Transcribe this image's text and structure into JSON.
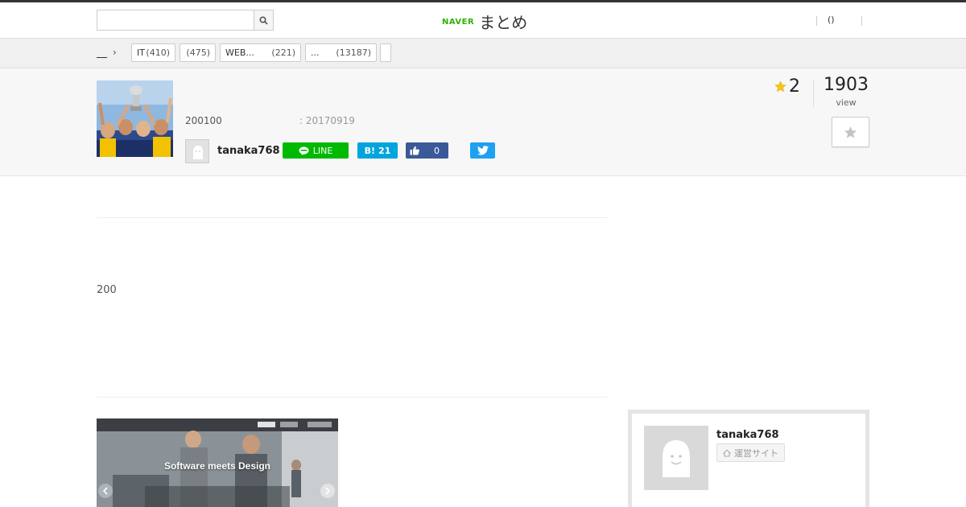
{
  "header": {
    "search": {
      "value": "",
      "placeholder": ""
    },
    "logo_brand": "NAVER",
    "logo_text": "まとめ",
    "user_link": "()"
  },
  "category_bar": {
    "chips": [
      {
        "label": "IT",
        "count": "(410)"
      },
      {
        "label": "",
        "count": "(475)"
      },
      {
        "label": "WEB...",
        "count": "(221)"
      },
      {
        "label": "...",
        "count": "(13187)"
      },
      {
        "label": "",
        "count": ""
      }
    ]
  },
  "summary": {
    "description": "200100",
    "updated": ": 20170919",
    "author": "tanaka768",
    "share": {
      "line_label": "LINE",
      "hatena_icon_text": "B!",
      "hatena_count": "21",
      "facebook_count": "0"
    },
    "favorites": "2",
    "views": "1903",
    "views_label": "view"
  },
  "main": {
    "body_number": "200",
    "hero_caption": "Software meets Design"
  },
  "sidebar": {
    "author": "tanaka768",
    "site_button": "運営サイト"
  },
  "colors": {
    "naver_green": "#2db400",
    "line_green": "#00b900",
    "hatena_blue": "#00a4de",
    "facebook_blue": "#3b5998",
    "twitter_blue": "#1da1f2",
    "star_gold": "#f5c518"
  }
}
